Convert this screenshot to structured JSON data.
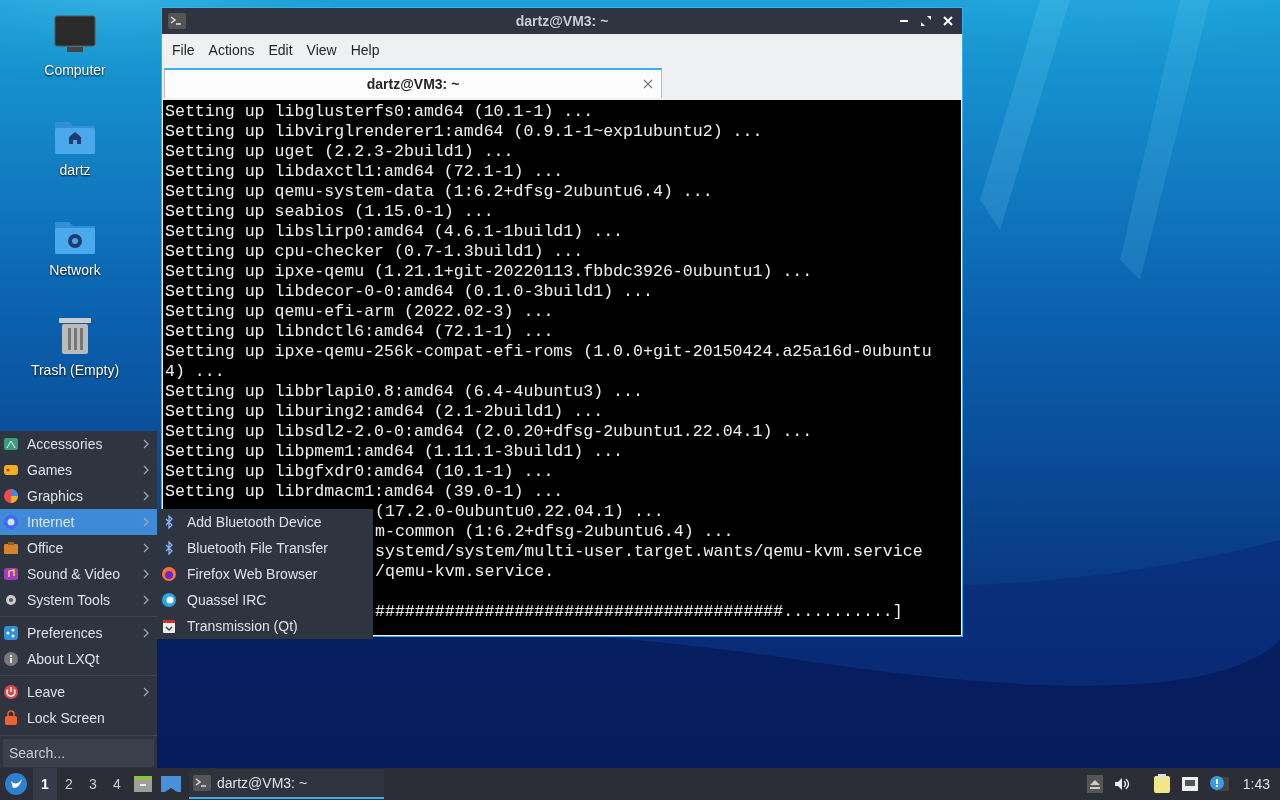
{
  "desktop_icons": [
    {
      "label": "Computer",
      "kind": "computer"
    },
    {
      "label": "dartz",
      "kind": "home"
    },
    {
      "label": "Network",
      "kind": "network"
    },
    {
      "label": "Trash (Empty)",
      "kind": "trash"
    }
  ],
  "terminal": {
    "title": "dartz@VM3: ~",
    "menu": [
      "File",
      "Actions",
      "Edit",
      "View",
      "Help"
    ],
    "tabs": [
      {
        "label": "dartz@VM3: ~",
        "selected": true
      }
    ],
    "lines": [
      {
        "kind": "full",
        "text": "Setting up libglusterfs0:amd64 (10.1-1) ..."
      },
      {
        "kind": "full",
        "text": "Setting up libvirglrenderer1:amd64 (0.9.1-1~exp1ubuntu2) ..."
      },
      {
        "kind": "full",
        "text": "Setting up uget (2.2.3-2build1) ..."
      },
      {
        "kind": "full",
        "text": "Setting up libdaxctl1:amd64 (72.1-1) ..."
      },
      {
        "kind": "full",
        "text": "Setting up qemu-system-data (1:6.2+dfsg-2ubuntu6.4) ..."
      },
      {
        "kind": "full",
        "text": "Setting up seabios (1.15.0-1) ..."
      },
      {
        "kind": "full",
        "text": "Setting up libslirp0:amd64 (4.6.1-1build1) ..."
      },
      {
        "kind": "full",
        "text": "Setting up cpu-checker (0.7-1.3build1) ..."
      },
      {
        "kind": "full",
        "text": "Setting up ipxe-qemu (1.21.1+git-20220113.fbbdc3926-0ubuntu1) ..."
      },
      {
        "kind": "full",
        "text": "Setting up libdecor-0-0:amd64 (0.1.0-3build1) ..."
      },
      {
        "kind": "full",
        "text": "Setting up qemu-efi-arm (2022.02-3) ..."
      },
      {
        "kind": "full",
        "text": "Setting up libndctl6:amd64 (72.1-1) ..."
      },
      {
        "kind": "full",
        "text": "Setting up ipxe-qemu-256k-compat-efi-roms (1.0.0+git-20150424.a25a16d-0ubuntu"
      },
      {
        "kind": "full",
        "text": "4) ..."
      },
      {
        "kind": "full",
        "text": "Setting up libbrlapi0.8:amd64 (6.4-4ubuntu3) ..."
      },
      {
        "kind": "full",
        "text": "Setting up liburing2:amd64 (2.1-2build1) ..."
      },
      {
        "kind": "full",
        "text": "Setting up libsdl2-2.0-0:amd64 (2.0.20+dfsg-2ubuntu1.22.04.1) ..."
      },
      {
        "kind": "full",
        "text": "Setting up libpmem1:amd64 (1.11.1-3build1) ..."
      },
      {
        "kind": "full",
        "text": "Setting up libgfxdr0:amd64 (10.1-1) ..."
      },
      {
        "kind": "full",
        "text": "Setting up librdmacm1:amd64 (39.0-1) ..."
      },
      {
        "kind": "tail",
        "text": "(17.2.0-0ubuntu0.22.04.1) ..."
      },
      {
        "kind": "tail",
        "text": "m-common (1:6.2+dfsg-2ubuntu6.4) ..."
      },
      {
        "kind": "tail",
        "text": "systemd/system/multi-user.target.wants/qemu-kvm.service"
      },
      {
        "kind": "tail",
        "text": "/qemu-kvm.service."
      },
      {
        "kind": "blank"
      },
      {
        "kind": "tail",
        "text": "#########################################...........]"
      }
    ]
  },
  "start_menu": {
    "sections": [
      [
        {
          "label": "Accessories",
          "kind": "submenu",
          "selected": false
        },
        {
          "label": "Games",
          "kind": "submenu",
          "selected": false
        },
        {
          "label": "Graphics",
          "kind": "submenu",
          "selected": false
        },
        {
          "label": "Internet",
          "kind": "submenu",
          "selected": true
        },
        {
          "label": "Office",
          "kind": "submenu",
          "selected": false
        },
        {
          "label": "Sound & Video",
          "kind": "submenu",
          "selected": false
        },
        {
          "label": "System Tools",
          "kind": "submenu",
          "selected": false
        }
      ],
      [
        {
          "label": "Preferences",
          "kind": "submenu",
          "selected": false
        },
        {
          "label": "About LXQt",
          "kind": "action",
          "selected": false
        }
      ],
      [
        {
          "label": "Leave",
          "kind": "submenu",
          "selected": false
        },
        {
          "label": "Lock Screen",
          "kind": "action",
          "selected": false
        }
      ]
    ],
    "submenu": [
      {
        "label": "Add Bluetooth Device",
        "kind": "bluetooth"
      },
      {
        "label": "Bluetooth File Transfer",
        "kind": "bluetooth"
      },
      {
        "label": "Firefox Web Browser",
        "kind": "browser"
      },
      {
        "label": "Quassel IRC",
        "kind": "chat"
      },
      {
        "label": "Transmission (Qt)",
        "kind": "torrent"
      }
    ],
    "search": {
      "placeholder": "Search..."
    }
  },
  "taskbar": {
    "desktops": [
      {
        "label": "1",
        "selected": true
      },
      {
        "label": "2",
        "selected": false
      },
      {
        "label": "3",
        "selected": false
      },
      {
        "label": "4",
        "selected": false
      }
    ],
    "tasks": [
      {
        "label": "dartz@VM3: ~",
        "selected": true
      }
    ],
    "clock": "1:43"
  }
}
